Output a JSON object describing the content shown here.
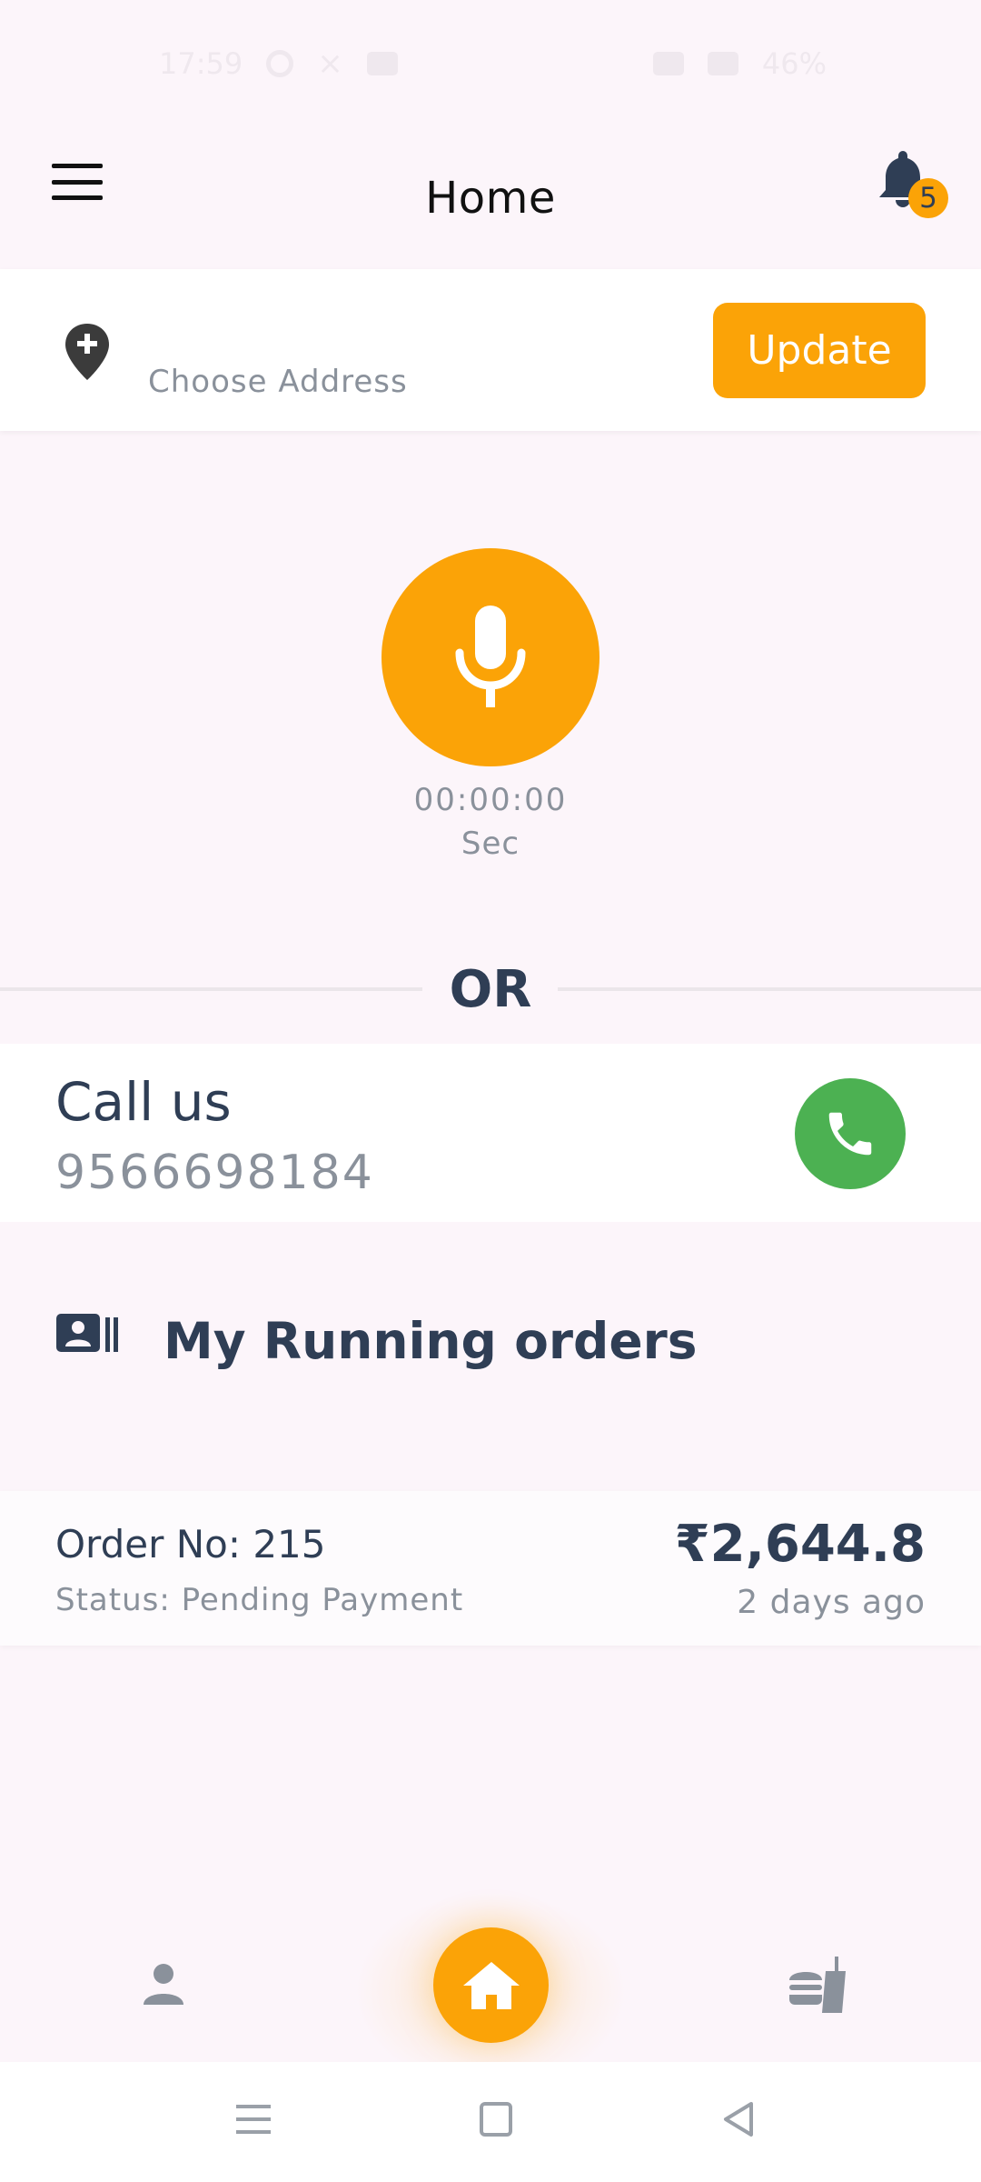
{
  "status_bar": {
    "time": "17:59",
    "battery": "46%"
  },
  "header": {
    "title": "Home",
    "notification_count": "5"
  },
  "address": {
    "placeholder": "Choose Address",
    "update_label": "Update"
  },
  "recorder": {
    "timer": "00:00:00",
    "unit": "Sec"
  },
  "divider": {
    "label": "OR"
  },
  "call": {
    "title": "Call us",
    "number": "9566698184"
  },
  "orders": {
    "heading": "My Running orders",
    "items": [
      {
        "order_no": "Order No: 215",
        "status": "Status: Pending Payment",
        "amount": "₹2,644.8",
        "time": "2 days ago"
      }
    ]
  },
  "colors": {
    "accent": "#fba307",
    "call_green": "#4cb152",
    "text_dark": "#2f3e55",
    "text_muted": "#8a919b"
  },
  "bottom_nav": {
    "items": [
      "profile-icon",
      "home-icon",
      "food-icon"
    ],
    "active": "home-icon"
  }
}
